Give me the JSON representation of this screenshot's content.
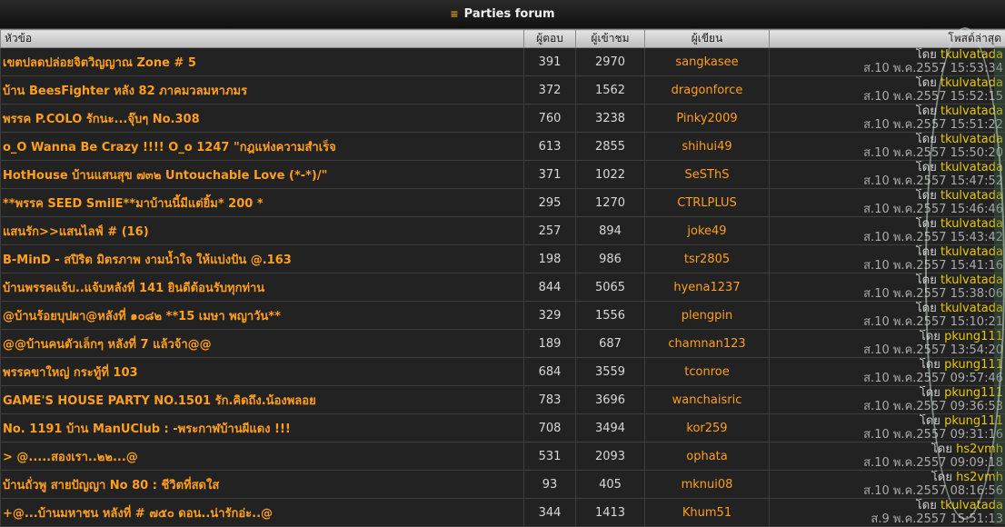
{
  "title": "Parties forum",
  "header": {
    "topic": "หัวข้อ",
    "replies": "ผู้ตอบ",
    "views": "ผู้เข้าชม",
    "author": "ผู้เขียน",
    "last": "โพสต์ล่าสุด"
  },
  "by_label": "โดย",
  "rows": [
    {
      "topic": "เขตปลดปล่อยจิตวิญญาณ Zone # 5",
      "replies": "391",
      "views": "2970",
      "author": "sangkasee",
      "last_by": "tkulvatada",
      "last_time": "ส.10 พ.ค.2557 15:53:34"
    },
    {
      "topic": "บ้าน BeesFighter หลัง 82 ภาคมวลมหาภมร",
      "replies": "372",
      "views": "1562",
      "author": "dragonforce",
      "last_by": "tkulvatada",
      "last_time": "ส.10 พ.ค.2557 15:52:15"
    },
    {
      "topic": "พรรค P.COLO รักนะ...จุ๊บๆ No.308",
      "replies": "760",
      "views": "3238",
      "author": "Pinky2009",
      "last_by": "tkulvatada",
      "last_time": "ส.10 พ.ค.2557 15:51:22"
    },
    {
      "topic": "o_O Wanna Be Crazy !!!! O_o 1247 \"กฎแห่งความสำเร็จ",
      "replies": "613",
      "views": "2855",
      "author": "shihui49",
      "last_by": "tkulvatada",
      "last_time": "ส.10 พ.ค.2557 15:50:20"
    },
    {
      "topic": "HotHouse บ้านแสนสุข ๗๓๒ Untouchable Love (*-*)/\"",
      "replies": "371",
      "views": "1022",
      "author": "SeSThS",
      "last_by": "tkulvatada",
      "last_time": "ส.10 พ.ค.2557 15:47:52"
    },
    {
      "topic": "**พรรค SEED SmilE**มาบ้านนี้มีแต่ยิ้ม* 200 *",
      "replies": "295",
      "views": "1270",
      "author": "CTRLPLUS",
      "last_by": "tkulvatada",
      "last_time": "ส.10 พ.ค.2557 15:46:46"
    },
    {
      "topic": "แสนรัก>>แสนไลฟ์ # (16)",
      "replies": "257",
      "views": "894",
      "author": "joke49",
      "last_by": "tkulvatada",
      "last_time": "ส.10 พ.ค.2557 15:43:42"
    },
    {
      "topic": "B-MinD - สปิริต มิตรภาพ งามน้ำใจ ให้แบ่งปัน @.163",
      "replies": "198",
      "views": "986",
      "author": "tsr2805",
      "last_by": "tkulvatada",
      "last_time": "ส.10 พ.ค.2557 15:41:16"
    },
    {
      "topic": "บ้านพรรคแจ้บ..แจ้บหลังที่ 141 ยินดีต้อนรับทุกท่าน",
      "replies": "844",
      "views": "5065",
      "author": "hyena1237",
      "last_by": "tkulvatada",
      "last_time": "ส.10 พ.ค.2557 15:38:06"
    },
    {
      "topic": "@บ้านร้อยบุปผา@หลังที่ ๑๐๘๒ **15 เมษา พญาวัน**",
      "replies": "329",
      "views": "1556",
      "author": "plengpin",
      "last_by": "tkulvatada",
      "last_time": "ส.10 พ.ค.2557 15:10:21"
    },
    {
      "topic": "@@บ้านคนตัวเล็กๆ หลังที่ 7 แล้วจ้า@@",
      "replies": "189",
      "views": "687",
      "author": "chamnan123",
      "last_by": "pkung111",
      "last_time": "ส.10 พ.ค.2557 13:54:20"
    },
    {
      "topic": "พรรคขาใหญ่ กระทู้ที่ 103",
      "replies": "684",
      "views": "3559",
      "author": "tconroe",
      "last_by": "pkung111",
      "last_time": "ส.10 พ.ค.2557 09:57:46"
    },
    {
      "topic": "GAME'S HOUSE PARTY NO.1501 รัก.คิดถึง.น้องพลอย",
      "replies": "783",
      "views": "3696",
      "author": "wanchaisric",
      "last_by": "pkung111",
      "last_time": "ส.10 พ.ค.2557 09:36:53"
    },
    {
      "topic": "No. 1191 บ้าน ManUClub : -พระกาฬบ้านผีแดง !!!",
      "replies": "708",
      "views": "3494",
      "author": "kor259",
      "last_by": "pkung111",
      "last_time": "ส.10 พ.ค.2557 09:31:16"
    },
    {
      "topic": "> @.....สองเรา..๒๒...@",
      "replies": "531",
      "views": "2093",
      "author": "ophata",
      "last_by": "hs2vmh",
      "last_time": "ส.10 พ.ค.2557 09:09:18"
    },
    {
      "topic": "บ้านถั่วพู สายปัญญา No 80 : ชีวิตที่สดใส",
      "replies": "93",
      "views": "405",
      "author": "mknui08",
      "last_by": "hs2vmh",
      "last_time": "ส.10 พ.ค.2557 08:16:56"
    },
    {
      "topic": "+@...บ้านมหาชน หลังที่ # ๗๕๐ ดอน..น่ารักอ่ะ..@",
      "replies": "344",
      "views": "1413",
      "author": "Khum51",
      "last_by": "tkulvatada",
      "last_time": "ส.9 พ.ค.2557 15:51:13"
    }
  ]
}
